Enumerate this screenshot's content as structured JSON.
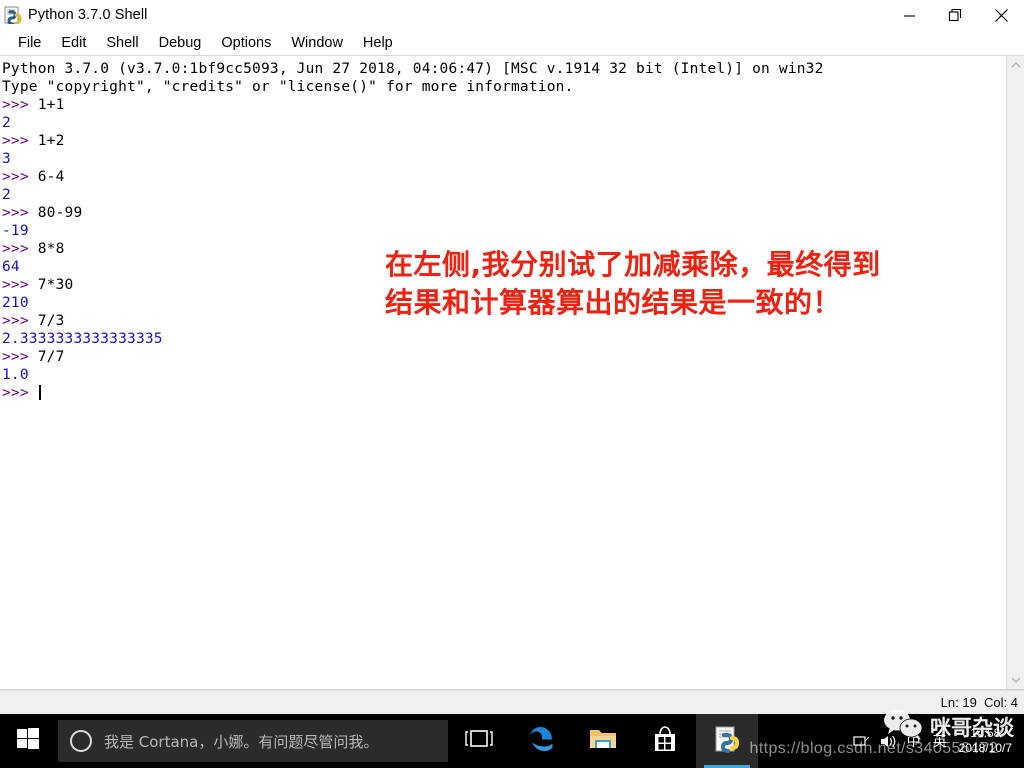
{
  "window": {
    "title": "Python 3.7.0 Shell",
    "icon": "python-idle-icon",
    "controls": {
      "minimize": "Minimize",
      "restore": "Restore",
      "close": "Close"
    }
  },
  "menu": {
    "items": [
      {
        "label": "File"
      },
      {
        "label": "Edit"
      },
      {
        "label": "Shell"
      },
      {
        "label": "Debug"
      },
      {
        "label": "Options"
      },
      {
        "label": "Window"
      },
      {
        "label": "Help"
      }
    ]
  },
  "shell": {
    "lines": [
      {
        "kind": "banner",
        "text": "Python 3.7.0 (v3.7.0:1bf9cc5093, Jun 27 2018, 04:06:47) [MSC v.1914 32 bit (Intel)] on win32"
      },
      {
        "kind": "banner",
        "text": "Type \"copyright\", \"credits\" or \"license()\" for more information."
      },
      {
        "kind": "input",
        "prompt": ">>> ",
        "text": "1+1"
      },
      {
        "kind": "output",
        "text": "2"
      },
      {
        "kind": "input",
        "prompt": ">>> ",
        "text": "1+2"
      },
      {
        "kind": "output",
        "text": "3"
      },
      {
        "kind": "input",
        "prompt": ">>> ",
        "text": "6-4"
      },
      {
        "kind": "output",
        "text": "2"
      },
      {
        "kind": "input",
        "prompt": ">>> ",
        "text": "80-99"
      },
      {
        "kind": "output",
        "text": "-19"
      },
      {
        "kind": "input",
        "prompt": ">>> ",
        "text": "8*8"
      },
      {
        "kind": "output",
        "text": "64"
      },
      {
        "kind": "input",
        "prompt": ">>> ",
        "text": "7*30"
      },
      {
        "kind": "output",
        "text": "210"
      },
      {
        "kind": "input",
        "prompt": ">>> ",
        "text": "7/3"
      },
      {
        "kind": "output",
        "text": "2.3333333333333335"
      },
      {
        "kind": "input",
        "prompt": ">>> ",
        "text": "7/7"
      },
      {
        "kind": "output",
        "text": "1.0"
      },
      {
        "kind": "cursor",
        "prompt": ">>> ",
        "text": ""
      }
    ],
    "colors": {
      "prompt": "#6b0080",
      "output": "#1313c6",
      "input": "#000000"
    }
  },
  "annotation": {
    "line1": "在左侧,我分别试了加减乘除，最终得到",
    "line2": "结果和计算器算出的结果是一致的！",
    "color": "#ee2211"
  },
  "status": {
    "text": "Ln: 19  Col: 4"
  },
  "taskbar": {
    "start": "start-button",
    "cortana_placeholder": "我是 Cortana，小娜。有问题尽管问我。",
    "apps": [
      {
        "name": "task-view",
        "label": "Task View",
        "active": false
      },
      {
        "name": "microsoft-edge",
        "label": "Microsoft Edge",
        "active": false
      },
      {
        "name": "file-explorer",
        "label": "File Explorer",
        "active": false
      },
      {
        "name": "microsoft-store",
        "label": "Microsoft Store",
        "active": false
      },
      {
        "name": "python-idle",
        "label": "Python 3.7.0 Shell",
        "active": true
      }
    ],
    "tray": {
      "ime_cn": "中",
      "ime_en": "英"
    },
    "clock": {
      "time": "14:58",
      "date": "2018/10/7"
    }
  },
  "watermarks": {
    "wechat": "咪哥杂谈",
    "csdn": "https://blog.csdn.net/s340556472"
  }
}
